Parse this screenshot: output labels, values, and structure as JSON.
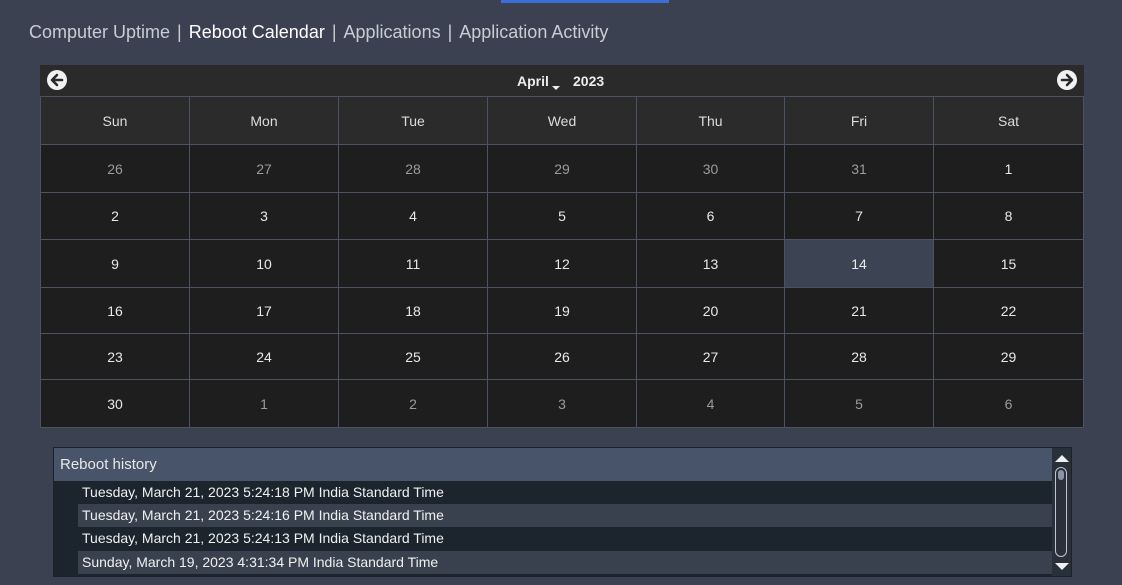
{
  "nav": {
    "items": [
      {
        "label": "Computer Uptime",
        "active": false
      },
      {
        "label": "Reboot Calendar",
        "active": true
      },
      {
        "label": "Applications",
        "active": false
      },
      {
        "label": "Application Activity",
        "active": false
      }
    ],
    "separator": "|"
  },
  "calendar": {
    "month": "April",
    "year": "2023",
    "prev_icon": "arrow-left-circle-icon",
    "next_icon": "arrow-right-circle-icon",
    "weekdays": [
      "Sun",
      "Mon",
      "Tue",
      "Wed",
      "Thu",
      "Fri",
      "Sat"
    ],
    "weeks": [
      [
        "26",
        "27",
        "28",
        "29",
        "30",
        "31",
        "1"
      ],
      [
        "2",
        "3",
        "4",
        "5",
        "6",
        "7",
        "8"
      ],
      [
        "9",
        "10",
        "11",
        "12",
        "13",
        "14",
        "15"
      ],
      [
        "16",
        "17",
        "18",
        "19",
        "20",
        "21",
        "22"
      ],
      [
        "23",
        "24",
        "25",
        "26",
        "27",
        "28",
        "29"
      ],
      [
        "30",
        "1",
        "2",
        "3",
        "4",
        "5",
        "6"
      ]
    ],
    "other_month_cells": [
      [
        0,
        0
      ],
      [
        0,
        1
      ],
      [
        0,
        2
      ],
      [
        0,
        3
      ],
      [
        0,
        4
      ],
      [
        0,
        5
      ],
      [
        5,
        1
      ],
      [
        5,
        2
      ],
      [
        5,
        3
      ],
      [
        5,
        4
      ],
      [
        5,
        5
      ],
      [
        5,
        6
      ]
    ],
    "selected_cell": [
      2,
      5
    ],
    "colors": {
      "selected_bg": "#3c4352",
      "cell_bg": "#1e1e1e",
      "header_bg": "#2b2b2b"
    }
  },
  "reboot_history": {
    "title": "Reboot history",
    "entries": [
      "Tuesday, March 21, 2023 5:24:18 PM India Standard Time",
      "Tuesday, March 21, 2023 5:24:16 PM India Standard Time",
      "Tuesday, March 21, 2023 5:24:13 PM India Standard Time",
      "Sunday, March 19, 2023 4:31:34 PM India Standard Time"
    ]
  }
}
